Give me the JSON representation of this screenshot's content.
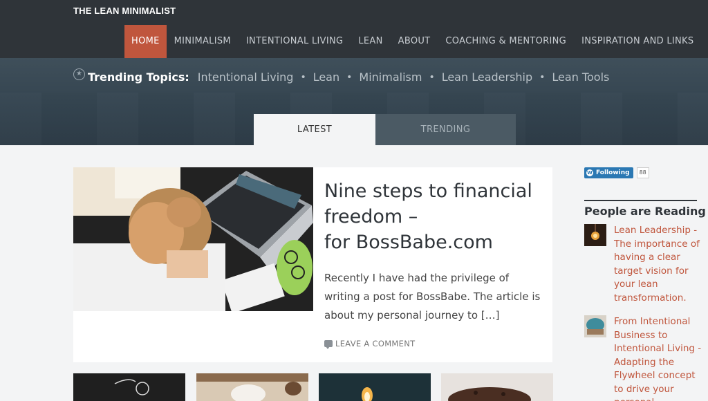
{
  "site": {
    "title": "THE LEAN MINIMALIST"
  },
  "nav": {
    "items": [
      {
        "label": "HOME"
      },
      {
        "label": "MINIMALISM"
      },
      {
        "label": "INTENTIONAL LIVING"
      },
      {
        "label": "LEAN"
      },
      {
        "label": "ABOUT"
      },
      {
        "label": "COACHING & MENTORING"
      },
      {
        "label": "INSPIRATION AND LINKS"
      }
    ],
    "active": "HOME"
  },
  "trending": {
    "label": "Trending Topics:",
    "icon": "star-icon",
    "topics": [
      "Intentional Living",
      "Lean",
      "Minimalism",
      "Lean Leadership",
      "Lean Tools"
    ]
  },
  "tabs": [
    {
      "label": "LATEST"
    },
    {
      "label": "TRENDING"
    }
  ],
  "featured": {
    "title_lines": [
      "Nine steps to financial",
      "freedom –",
      "for BossBabe.com"
    ],
    "excerpt": "Recently I have had the privilege of writing a post for BossBabe. The article is about my personal journey to […]",
    "comment_label": "LEAVE A COMMENT"
  },
  "sidebar": {
    "follow": {
      "label": "Following",
      "count": "88",
      "icon": "wordpress-icon"
    },
    "heading": "People are Reading",
    "items": [
      {
        "title": "Lean Leadership - The importance of having a clear target vision for your lean transformation."
      },
      {
        "title": "From Intentional Business to Intentional Living - Adapting the Flywheel concept to drive your personal"
      }
    ]
  },
  "colors": {
    "header_bg": "#2f3439",
    "accent": "#c0563d",
    "band_bg": "#3f4f5a",
    "follow_blue": "#2b78b3"
  }
}
